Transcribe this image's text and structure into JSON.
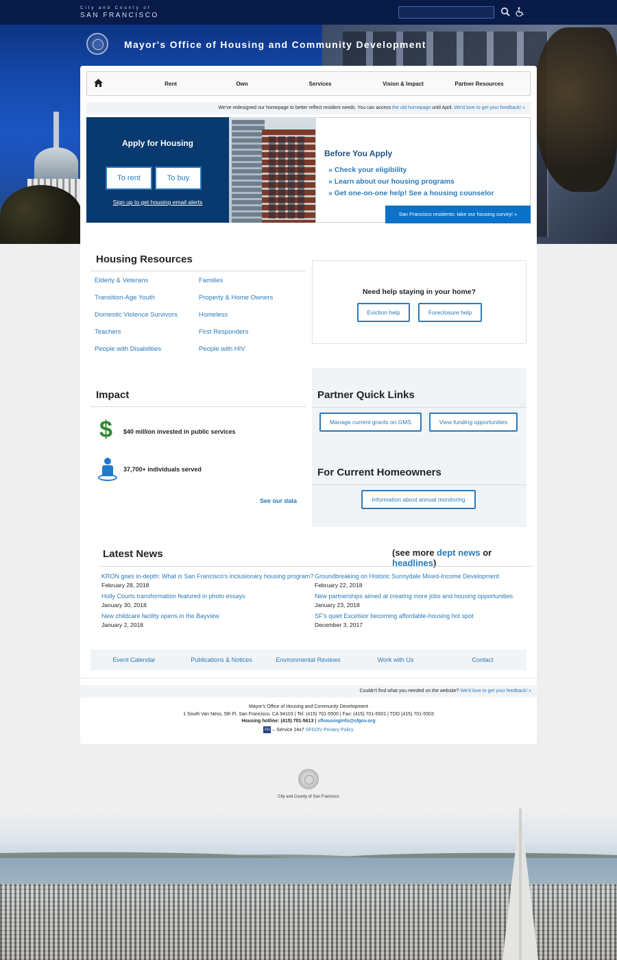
{
  "topbar": {
    "city_small": "City and County of",
    "city_big": "SAN FRANCISCO"
  },
  "icons": {
    "search": "search-icon",
    "accessibility": "accessibility-icon",
    "home": "home-icon"
  },
  "site_title": "Mayor's Office of Housing and Community Development",
  "nav": {
    "items": [
      "Rent",
      "Own",
      "Services",
      "Vision & Impact",
      "Partner Resources"
    ]
  },
  "notice": {
    "text_before": "We've redesigned our homepage to better reflect resident needs. You can access ",
    "old_link": "the old homepage",
    "text_after": " until April. ",
    "feedback_link": "We'd love to get your feedback! »"
  },
  "apply": {
    "title": "Apply for Housing",
    "rent_label": "To rent",
    "buy_label": "To buy",
    "alerts_link": "Sign up to get housing email alerts"
  },
  "before": {
    "title": "Before You Apply",
    "links": [
      "» Check your eligibility",
      "» Learn about our housing programs",
      "» Get one-on-one help! See a housing counselor"
    ],
    "survey_label": "San Francisco residents: take our housing survey! »"
  },
  "resources": {
    "title": "Housing Resources",
    "left": [
      "Elderly & Veterans",
      "Transition-Age Youth",
      "Domestic Violence Survivors",
      "Teachers",
      "People with Disabilities"
    ],
    "right": [
      "Families",
      "Property & Home Owners",
      "Homeless",
      "First Responders",
      "People with HIV"
    ]
  },
  "help": {
    "question": "Need help staying in your home?",
    "eviction_label": "Eviction help",
    "foreclosure_label": "Foreclosure help"
  },
  "impact": {
    "title": "Impact",
    "stat1": "$40 million invested in public services",
    "stat2": "37,700+ individuals served",
    "see_data": "See our data"
  },
  "partner": {
    "title": "Partner Quick Links",
    "gms_label": "Manage current grants on GMS",
    "funding_label": "View funding opportunities"
  },
  "homeowners": {
    "title": "For Current Homeowners",
    "monitoring_label": "Information about annual monitoring"
  },
  "news": {
    "title": "Latest News",
    "see_more_open": "(see more ",
    "dept_news": "dept news",
    "or": " or ",
    "headlines": "headlines",
    "see_more_close": ")",
    "items_left": [
      {
        "title": "KRON goes in-depth: What is San Francisco's inclusionary housing program?",
        "date": "February 28, 2018"
      },
      {
        "title": "Holly Courts transformation featured in photo essays",
        "date": "January 30, 2018"
      },
      {
        "title": "New childcare facility opens in the Bayview",
        "date": "January 2, 2018"
      }
    ],
    "items_right": [
      {
        "title": "Groundbreaking on Historic Sunnydale Mixed-Income Development",
        "date": "February 22, 2018"
      },
      {
        "title": "New partnerships aimed at creating more jobs and housing opportunities",
        "date": "January 23, 2018"
      },
      {
        "title": "SF's quiet Excelsior becoming affordable-housing hot spot",
        "date": "December 3, 2017"
      }
    ]
  },
  "footer_nav": [
    "Event Calendar",
    "Publications & Notices",
    "Environmental Reviews",
    "Work with Us",
    "Contact"
  ],
  "couldnt": {
    "text": "Couldn't find what you needed on the website? ",
    "feedback_link": "We'd love to get your feedback! »"
  },
  "address": {
    "org": "Mayor's Office of Housing and Community Development",
    "line": "1 South Van Ness, 5th Fl. San Francisco, CA 94103  |  Tel: (415) 701-5500  |  Fax: (415) 701-5501  |  TDD (415) 701-5503",
    "hotline_label": "Housing hotline: (415) 701-5613",
    "email": "sfhousinginfo@sfgov.org",
    "badge": "311",
    "service": " – Service 24x7",
    "privacy": "SFGOV Privacy Policy"
  },
  "bottom": {
    "city_label": "City and County of San Francisco"
  }
}
